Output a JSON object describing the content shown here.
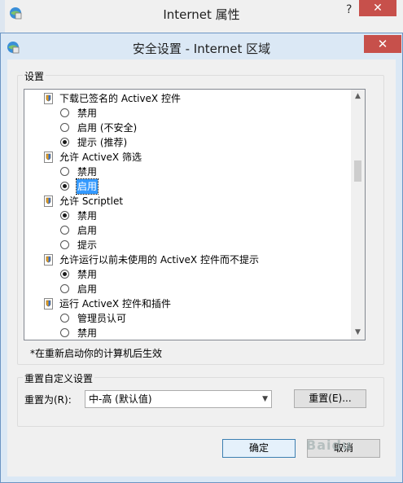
{
  "parent_window": {
    "title": "Internet 属性",
    "help": "?",
    "close": "✕"
  },
  "dialog": {
    "title": "安全设置 - Internet 区域",
    "close": "✕"
  },
  "settings": {
    "group_label": "设置",
    "categories": [
      {
        "label": "下载已签名的 ActiveX 控件",
        "options": [
          {
            "label": "禁用",
            "checked": false
          },
          {
            "label": "启用 (不安全)",
            "checked": false
          },
          {
            "label": "提示 (推荐)",
            "checked": true
          }
        ]
      },
      {
        "label": "允许 ActiveX 筛选",
        "options": [
          {
            "label": "禁用",
            "checked": false
          },
          {
            "label": "启用",
            "checked": true,
            "selected": true
          }
        ]
      },
      {
        "label": "允许 Scriptlet",
        "options": [
          {
            "label": "禁用",
            "checked": true
          },
          {
            "label": "启用",
            "checked": false
          },
          {
            "label": "提示",
            "checked": false
          }
        ]
      },
      {
        "label": "允许运行以前未使用的 ActiveX 控件而不提示",
        "options": [
          {
            "label": "禁用",
            "checked": true
          },
          {
            "label": "启用",
            "checked": false
          }
        ]
      },
      {
        "label": "运行 ActiveX 控件和插件",
        "options": [
          {
            "label": "管理员认可",
            "checked": false
          },
          {
            "label": "禁用",
            "checked": false
          }
        ]
      }
    ],
    "note": "*在重新启动你的计算机后生效"
  },
  "reset": {
    "group_label": "重置自定义设置",
    "reset_to_label": "重置为(R):",
    "level_value": "中-高 (默认值)",
    "reset_button": "重置(E)..."
  },
  "footer": {
    "ok": "确定",
    "cancel": "取消"
  },
  "watermark": "Baidu"
}
